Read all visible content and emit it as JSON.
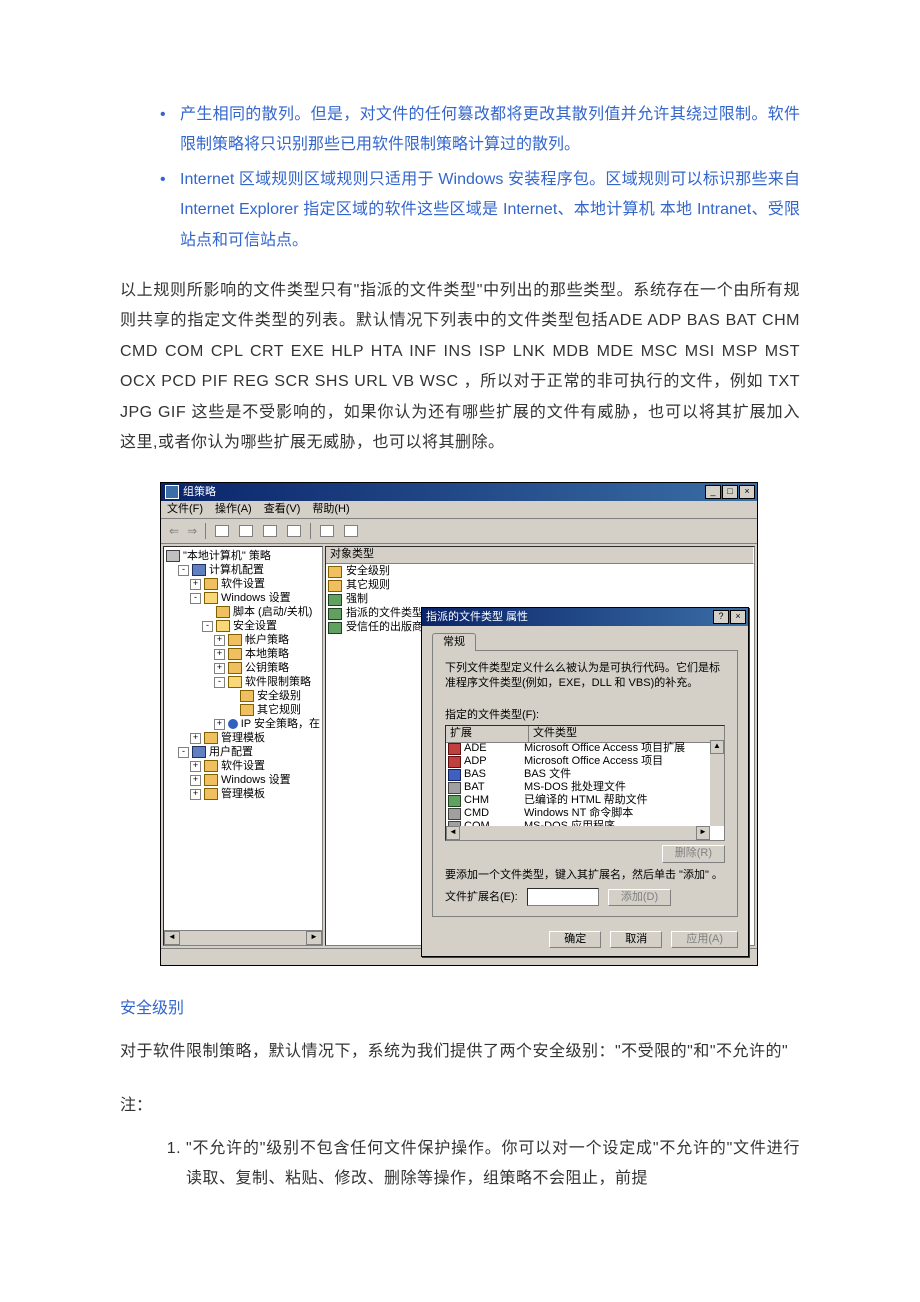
{
  "bullets": [
    "产生相同的散列。但是，对文件的任何篡改都将更改其散列值并允许其绕过限制。软件限制策略将只识别那些已用软件限制策略计算过的散列。",
    "Internet 区域规则区域规则只适用于 Windows 安装程序包。区域规则可以标识那些来自 Internet Explorer 指定区域的软件这些区域是 Internet、本地计算机 本地 Intranet、受限站点和可信站点。"
  ],
  "paragraph_1": "以上规则所影响的文件类型只有\"指派的文件类型\"中列出的那些类型。系统存在一个由所有规则共享的指定文件类型的列表。默认情况下列表中的文件类型包括ADE ADP BAS BAT CHM CMD COM CPL CRT EXE HLP HTA INF INS ISP LNK MDB MDE MSC MSI MSP MST OCX PCD PIF REG SCR SHS URL VB WSC ，所以对于正常的非可执行的文件，例如 TXT JPG GIF 这些是不受影响的，如果你认为还有哪些扩展的文件有威胁，也可以将其扩展加入这里,或者你认为哪些扩展无威胁，也可以将其删除。",
  "section_header": "安全级别",
  "paragraph_2": "对于软件限制策略，默认情况下，系统为我们提供了两个安全级别：\"不受限的\"和\"不允许的\"",
  "note_label": "注：",
  "numbered_1": "\"不允许的\"级别不包含任何文件保护操作。你可以对一个设定成\"不允许的\"文件进行读取、复制、粘贴、修改、删除等操作，组策略不会阻止，前提",
  "win": {
    "title": "组策略",
    "menu": [
      "文件(F)",
      "操作(A)",
      "查看(V)",
      "帮助(H)"
    ],
    "tree": {
      "root": "\"本地计算机\" 策略",
      "n1": "计算机配置",
      "n1a": "软件设置",
      "n1b": "Windows 设置",
      "n1b1": "脚本 (启动/关机)",
      "n1b2": "安全设置",
      "n1b2a": "帐户策略",
      "n1b2b": "本地策略",
      "n1b2c": "公钥策略",
      "n1b2d": "软件限制策略",
      "n1b2d1": "安全级别",
      "n1b2d2": "其它规则",
      "n1b2e": "IP 安全策略，在",
      "n1c": "管理模板",
      "n2": "用户配置",
      "n2a": "软件设置",
      "n2b": "Windows 设置",
      "n2c": "管理模板"
    },
    "list": {
      "header": "对象类型",
      "items": [
        "安全级别",
        "其它规则",
        "强制",
        "指派的文件类型",
        "受信任的出版商"
      ]
    },
    "dlg": {
      "title": "指派的文件类型 属性",
      "tab": "常规",
      "desc": "下列文件类型定义什么么被认为是可执行代码。它们是标准程序文件类型(例如，EXE，DLL 和 VBS)的补充。",
      "list_label": "指定的文件类型(F):",
      "col_ext": "扩展",
      "col_type": "文件类型",
      "rows": [
        {
          "ext": "ADE",
          "type": "Microsoft Office Access 项目扩展"
        },
        {
          "ext": "ADP",
          "type": "Microsoft Office Access 项目"
        },
        {
          "ext": "BAS",
          "type": "BAS 文件"
        },
        {
          "ext": "BAT",
          "type": "MS-DOS 批处理文件"
        },
        {
          "ext": "CHM",
          "type": "已编译的 HTML 帮助文件"
        },
        {
          "ext": "CMD",
          "type": "Windows NT 命令脚本"
        },
        {
          "ext": "COM",
          "type": "MS-DOS 应用程序"
        }
      ],
      "btn_delete": "删除(R)",
      "add_hint": "要添加一个文件类型，键入其扩展名，然后单击 \"添加\" 。",
      "ext_label": "文件扩展名(E):",
      "btn_add": "添加(D)",
      "btn_ok": "确定",
      "btn_cancel": "取消",
      "btn_apply": "应用(A)"
    }
  }
}
